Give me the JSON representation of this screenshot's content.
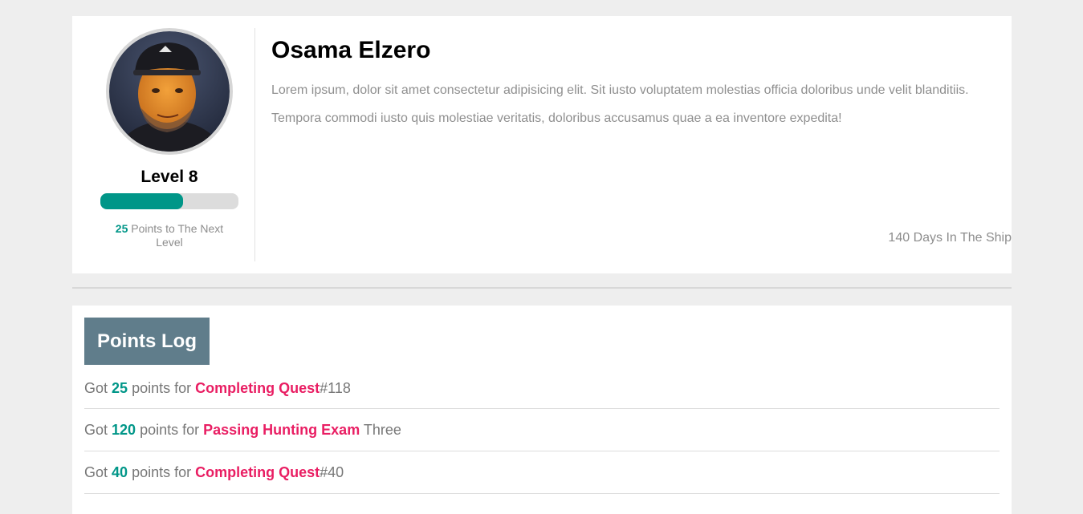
{
  "profile": {
    "name": "Osama Elzero",
    "level_label": "Level 8",
    "progress_fraction": 0.6,
    "points_to_next": "25",
    "points_to_next_text": "Points to The Next Level",
    "bio_lines": [
      "Lorem ipsum, dolor sit amet consectetur adipisicing elit. Sit iusto voluptatem molestias officia doloribus unde velit blanditiis.",
      "Tempora commodi iusto quis molestiae veritatis, doloribus accusamus quae a ea inventore expedita!"
    ],
    "days_text": "140 Days In The Ship"
  },
  "points_log": {
    "title": "Points Log",
    "entries": [
      {
        "prefix": "Got",
        "points": "25",
        "middle": "points for",
        "activity": "Completing Quest",
        "suffix": "#118"
      },
      {
        "prefix": "Got",
        "points": "120",
        "middle": "points for",
        "activity": "Passing Hunting Exam",
        "suffix": "Three"
      },
      {
        "prefix": "Got",
        "points": "40",
        "middle": "points for",
        "activity": "Completing Quest",
        "suffix": "#40"
      }
    ]
  },
  "colors": {
    "accent": "#009688",
    "highlight": "#e91e63",
    "heading_bg": "#607d8b",
    "page_bg": "#eeeeee"
  },
  "icons": {
    "avatar": "user-avatar-photo"
  }
}
